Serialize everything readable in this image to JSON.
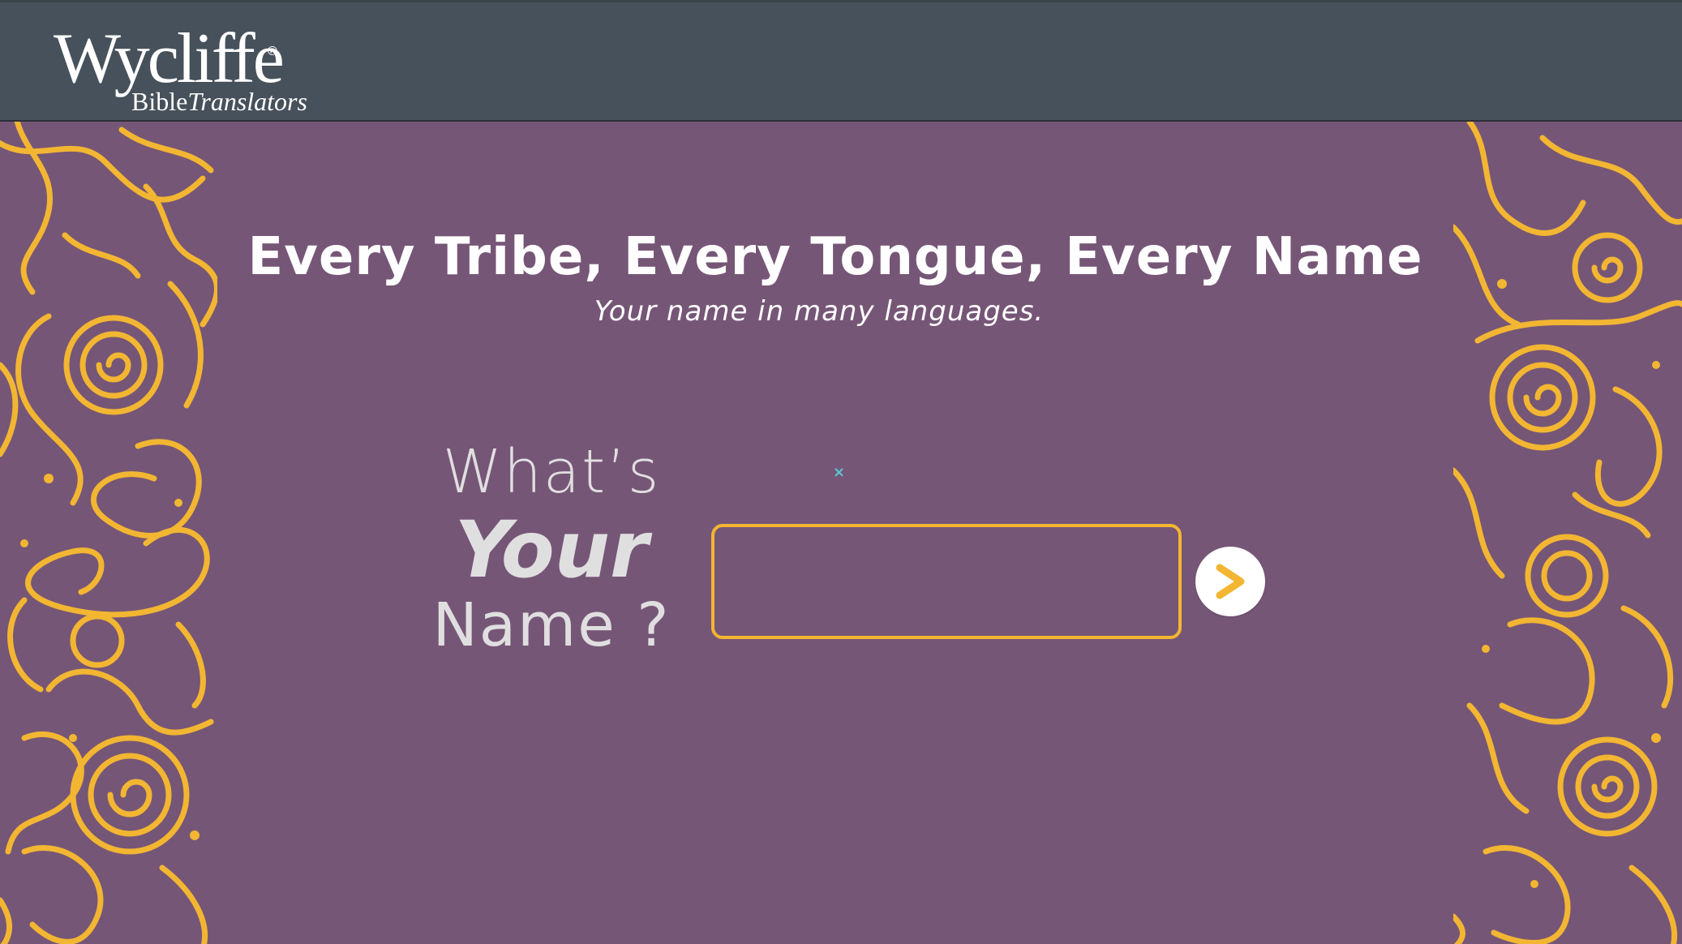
{
  "header": {
    "logo": {
      "name": "Wycliffe",
      "registered_mark": "®",
      "sub_upright": "Bible",
      "sub_italic": "Translators"
    }
  },
  "main": {
    "headline": "Every Tribe, Every Tongue, Every Name",
    "subheadline": "Your name in many languages.",
    "prompt": {
      "line1": "What’s",
      "line2": "Your",
      "line3": "Name ?"
    },
    "name_input": {
      "value": "",
      "placeholder": ""
    },
    "submit_button": {
      "icon": "chevron-right-icon",
      "label": ">"
    },
    "cursor_mark": "×"
  },
  "colors": {
    "header_bg": "#47515b",
    "page_bg": "#765676",
    "accent_gold": "#f2b632",
    "text_white": "#ffffff",
    "prompt_text": "#e0dfe0"
  },
  "decorations": {
    "left_pattern": "gold-paisley-pattern",
    "right_pattern": "gold-paisley-pattern"
  }
}
